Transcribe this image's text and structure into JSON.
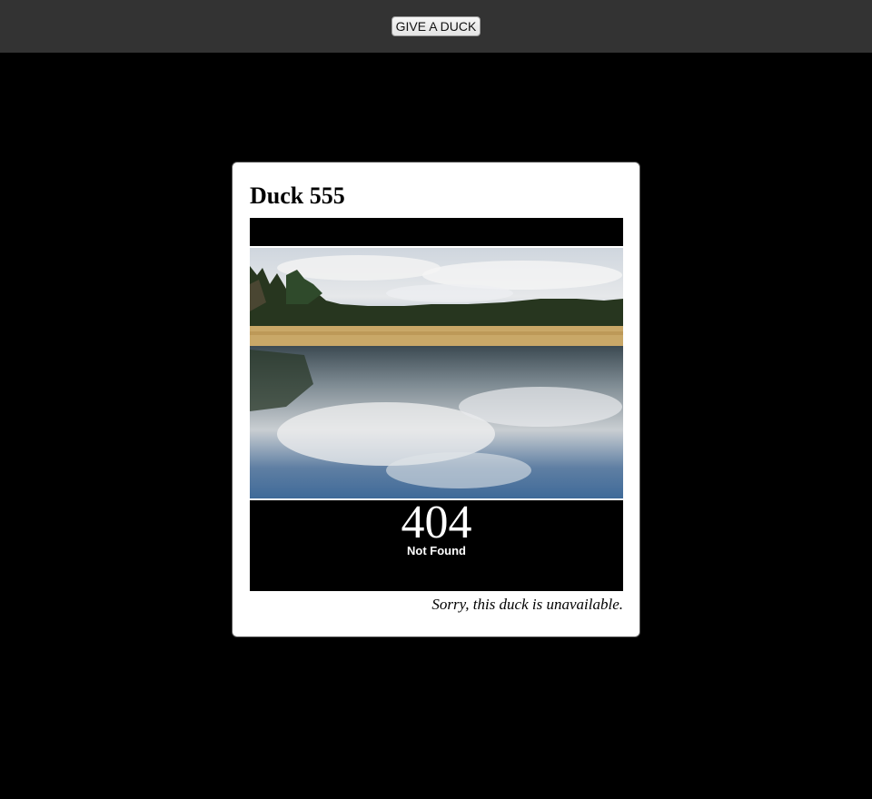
{
  "header": {
    "give_button_label": "GIVE A DUCK"
  },
  "card": {
    "title": "Duck 555",
    "error_code": "404",
    "error_text": "Not Found",
    "caption": "Sorry, this duck is unavailable."
  },
  "colors": {
    "topbar_bg": "#333333",
    "page_bg": "#000000",
    "card_bg": "#ffffff"
  }
}
